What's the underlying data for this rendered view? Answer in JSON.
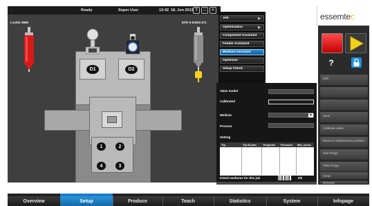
{
  "status_bar": {
    "state": "Ready",
    "user": "Super User",
    "time": "13:42",
    "date": "18. Jun 2013",
    "buttons": [
      "?",
      "□",
      "×"
    ]
  },
  "machine_view": {
    "loctite_label": "Loctite 3609",
    "efd_label": "EFD S-0mE3-271",
    "dispenser_heads": [
      "D1",
      "D2"
    ],
    "nozzles": [
      "1",
      "2",
      "4",
      "3"
    ]
  },
  "menu": {
    "items": [
      {
        "label": "Job",
        "arrow": "▶"
      },
      {
        "label": "Optimization",
        "arrow": "▶"
      },
      {
        "label": "Component Assistant",
        "arrow": ""
      },
      {
        "label": "Feeder Assistant",
        "arrow": ""
      },
      {
        "label": "Medium Assistant",
        "arrow": ""
      },
      {
        "label": "Optimizer",
        "arrow": ""
      },
      {
        "label": "Setup Check",
        "arrow": ""
      }
    ],
    "active_index": 4
  },
  "settings": {
    "valve_model_label": "Valve model",
    "calibrated_label": "Calibrated",
    "medium_label": "Medium",
    "medium_dropdown_arrow": "▼",
    "process_label": "Process",
    "setting_label": "Setting",
    "table_headers": [
      "Tip",
      "Tip Ø [mm",
      "Temperat",
      "Pressure",
      "Min. press"
    ],
    "kitted_label": "Kitted mediums for this job",
    "kitted_count": "0/0"
  },
  "brand": {
    "name_prefix": "essemte",
    "name_c": "c"
  },
  "colors": {
    "accent_blue": "#1a7bd0",
    "stop_red": "#e01010",
    "play_yellow": "#f2d21a",
    "dispenser_red": "#d91a1a",
    "cartridge_yellow": "#f7d21c"
  },
  "right_panel": {
    "help_icon": "?",
    "lock_icon": "lock-icon",
    "buttons": [
      "Edit",
      "",
      "",
      "Save",
      "Calibrate valve",
      "Move to maintenance position",
      "Gas Purge",
      "Time Purge",
      "Clean",
      "Rename"
    ]
  },
  "nav": {
    "tabs": [
      "Overview",
      "Setup",
      "Produce",
      "Teach",
      "Statistics",
      "System",
      "Infopage"
    ],
    "active_index": 1
  }
}
